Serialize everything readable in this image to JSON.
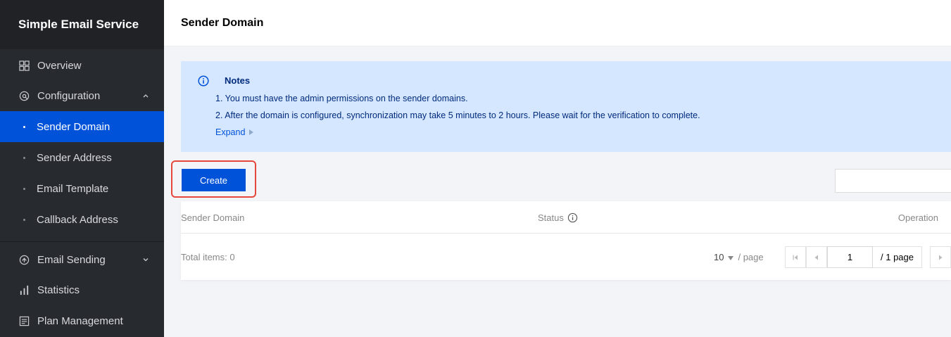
{
  "sidebar": {
    "title": "Simple Email Service",
    "items": [
      {
        "label": "Overview",
        "icon": "grid-icon"
      },
      {
        "label": "Configuration",
        "icon": "settings-icon",
        "expanded": true
      },
      {
        "label": "Email Sending",
        "icon": "send-icon",
        "expanded": false
      },
      {
        "label": "Statistics",
        "icon": "bar-chart-icon"
      },
      {
        "label": "Plan Management",
        "icon": "list-icon"
      }
    ],
    "subitems": [
      {
        "label": "Sender Domain",
        "active": true
      },
      {
        "label": "Sender Address"
      },
      {
        "label": "Email Template"
      },
      {
        "label": "Callback Address"
      }
    ]
  },
  "header": {
    "title": "Sender Domain"
  },
  "notes": {
    "title": "Notes",
    "lines": [
      "1. You must have the admin permissions on the sender domains.",
      "2. After the domain is configured, synchronization may take 5 minutes to 2 hours. Please wait for the verification to complete."
    ],
    "expand_label": "Expand"
  },
  "toolbar": {
    "create_label": "Create",
    "search_placeholder": ""
  },
  "table": {
    "columns": [
      "Sender Domain",
      "Status",
      "Operation"
    ],
    "rows": [],
    "footer": {
      "total_label": "Total items: 0",
      "page_size": "10",
      "page_size_unit": "/ page",
      "current_page": "1",
      "total_pages": "/ 1 page"
    }
  },
  "colors": {
    "sidebar_bg": "#272a2f",
    "accent": "#0052d9",
    "highlight": "#e5483b",
    "notes_bg": "#d5e7ff"
  }
}
